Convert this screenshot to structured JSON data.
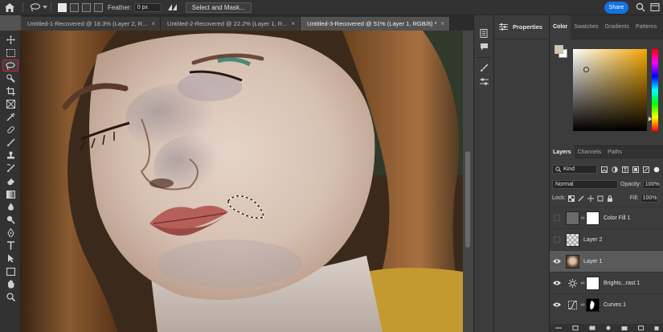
{
  "options_bar": {
    "feather_label": "Feather:",
    "feather_value": "0 px",
    "select_mask_label": "Select and Mask...",
    "share_label": "Share"
  },
  "tabs": [
    {
      "label": "Untitled-1-Recovered @ 18.3% (Layer 2, R...",
      "active": false
    },
    {
      "label": "Untitled-2-Recovered @ 22.2% (Layer 1, R...",
      "active": false
    },
    {
      "label": "Untitled-3-Recovered @ 51% (Layer 1, RGB/8) *",
      "active": true
    }
  ],
  "tools": [
    "move-tool",
    "marquee-tool",
    "lasso-tool",
    "quick-select-tool",
    "crop-tool",
    "frame-tool",
    "eyedropper-tool",
    "healing-brush-tool",
    "brush-tool",
    "clone-stamp-tool",
    "history-brush-tool",
    "eraser-tool",
    "gradient-tool",
    "blur-tool",
    "dodge-tool",
    "pen-tool",
    "type-tool",
    "path-select-tool",
    "rectangle-tool",
    "hand-tool",
    "zoom-tool"
  ],
  "properties": {
    "title": "Properties"
  },
  "color_panel": {
    "tabs": [
      "Color",
      "Swatches",
      "Gradients",
      "Patterns"
    ],
    "foreground": "#d4c6aa",
    "background": "#ffffff"
  },
  "layers_panel": {
    "tabs": [
      "Layers",
      "Channels",
      "Paths"
    ],
    "filter_kind": "Kind",
    "blend_mode": "Normal",
    "opacity_label": "Opacity:",
    "opacity_value": "100%",
    "lock_label": "Lock:",
    "fill_label": "Fill:",
    "fill_value": "100%",
    "layers": [
      {
        "name": "Color Fill 1",
        "visible": false
      },
      {
        "name": "Layer 2",
        "visible": false
      },
      {
        "name": "Layer 1",
        "visible": true,
        "selected": true
      },
      {
        "name": "Brights...rast 1",
        "visible": true
      },
      {
        "name": "Curves 1",
        "visible": true
      }
    ]
  }
}
